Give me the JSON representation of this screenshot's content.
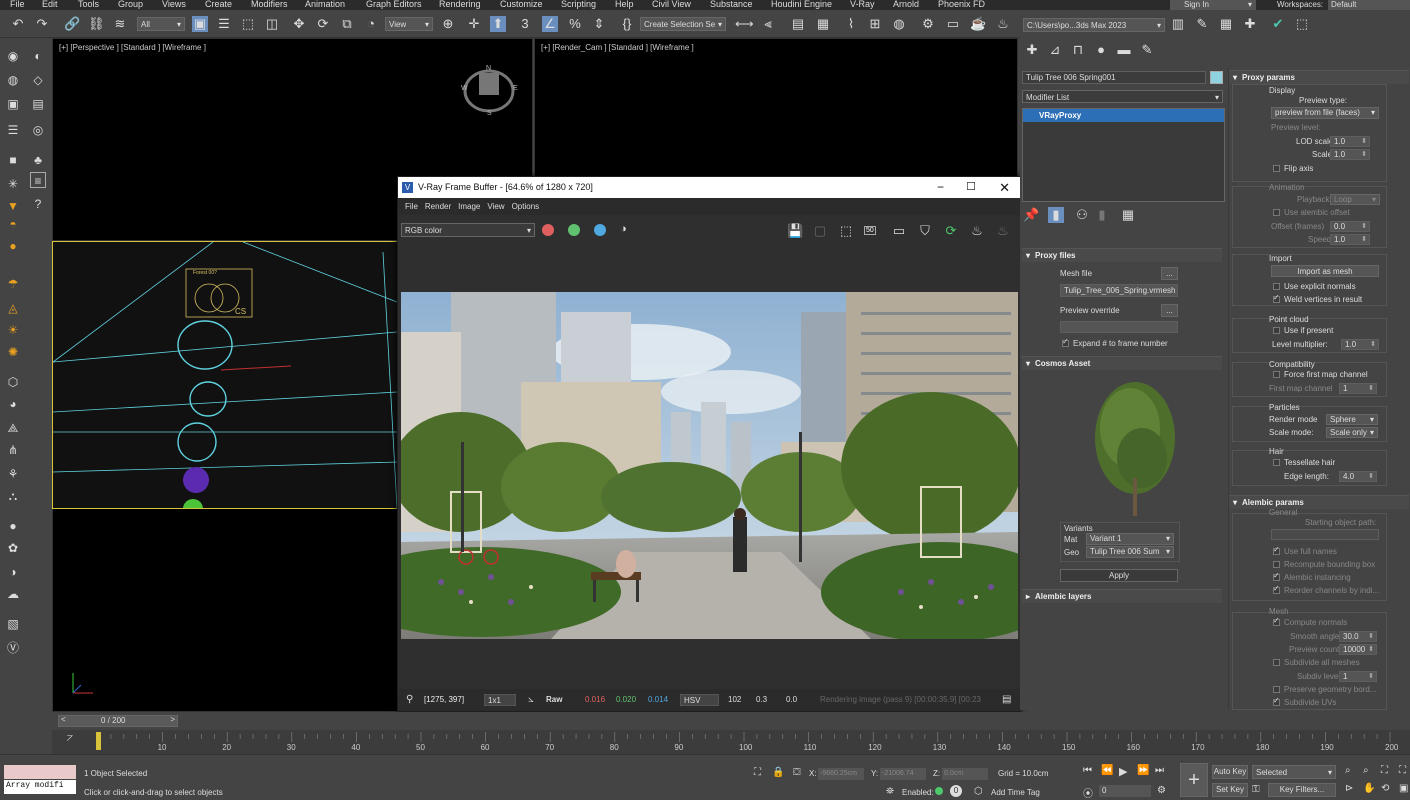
{
  "menu": [
    "File",
    "Edit",
    "Tools",
    "Group",
    "Views",
    "Create",
    "Modifiers",
    "Animation",
    "Graph Editors",
    "Rendering",
    "Customize",
    "Scripting",
    "Help",
    "Civil View",
    "Substance",
    "Houdini Engine",
    "V-Ray",
    "Arnold",
    "Phoenix FD"
  ],
  "signin": "Sign In",
  "workspaces_label": "Workspaces:",
  "workspaces_value": "Default",
  "toolbar": {
    "filter": "All",
    "ref_coord": "View",
    "selection_set": "Create Selection Se",
    "path": "C:\\Users\\po...3ds Max 2023"
  },
  "viewports": {
    "perspective": "[+] [Perspective ] [Standard ] [Wireframe ]",
    "render_cam": "[+] [Render_Cam ] [Standard ] [Wireframe ]",
    "compass_n": "N",
    "compass_w": "W",
    "compass_e": "E",
    "compass_s": "S",
    "forest_label": "Forest 00?",
    "cs_label": "CS"
  },
  "vfb": {
    "title": "V-Ray Frame Buffer - [64.6% of 1280 x 720]",
    "menu": [
      "Render",
      "Image",
      "View",
      "Options"
    ],
    "menu_file": "File",
    "channel": "RGB color",
    "zoom_badge": "50",
    "status": {
      "coords": "[1275, 397]",
      "scale": "1x1",
      "mode": "Raw",
      "r": "0.016",
      "g": "0.020",
      "b": "0.014",
      "space": "HSV",
      "h": "102",
      "s": "0.3",
      "v": "0.0",
      "msg": "Rendering image (pass 9) [00:00:35.9] [00:23"
    }
  },
  "colors": {
    "r": "#e06060",
    "g": "#60c070",
    "b": "#50a8e0",
    "selected": "#2d6fb6"
  },
  "cmd": {
    "object_name": "Tulip Tree 006 Spring001",
    "modifier_list": "Modifier List",
    "stack_item": "VRayProxy",
    "proxy_files": "Proxy files",
    "mesh_file_label": "Mesh file",
    "mesh_file": "Tulip_Tree_006_Spring.vrmesh",
    "preview_override": "Preview override",
    "browse": "...",
    "expand": "Expand # to frame number",
    "cosmos": "Cosmos Asset",
    "variants": "Variants",
    "mat_label": "Mat",
    "mat_value": "Variant 1",
    "geo_label": "Geo",
    "geo_value": "Tulip Tree 006 Sum",
    "apply": "Apply",
    "alembic_layers": "Alembic layers"
  },
  "props": {
    "proxy_params": "Proxy params",
    "display": "Display",
    "preview_type_label": "Preview type:",
    "preview_type": "preview from file (faces)",
    "preview_level": "Preview level:",
    "lod_scale_label": "LOD scale:",
    "lod_scale": "1.0",
    "scale_label": "Scale:",
    "scale": "1.0",
    "flip_axis": "Flip axis",
    "animation": "Animation",
    "playback_label": "Playback:",
    "playback": "Loop",
    "use_alembic_offset": "Use alembic offset",
    "offset_label": "Offset (frames)",
    "offset": "0.0",
    "speed_label": "Speed:",
    "speed": "1.0",
    "import": "Import",
    "import_as_mesh": "Import as mesh",
    "use_explicit_normals": "Use explicit normals",
    "weld_vertices": "Weld vertices in result",
    "point_cloud": "Point cloud",
    "use_if_present": "Use if present",
    "level_multiplier_label": "Level multiplier:",
    "level_multiplier": "1.0",
    "compatibility": "Compatibility",
    "force_first_map": "Force first map channel",
    "first_map_channel_label": "First map channel",
    "first_map_channel": "1",
    "particles": "Particles",
    "render_mode_label": "Render mode",
    "render_mode": "Sphere",
    "scale_mode_label": "Scale mode:",
    "scale_mode": "Scale only",
    "hair": "Hair",
    "tessellate_hair": "Tessellate hair",
    "edge_length_label": "Edge length:",
    "edge_length": "4.0",
    "alembic_params": "Alembic params",
    "general": "General",
    "starting_object_path": "Starting object path:",
    "use_full_names": "Use full names",
    "recompute_bbox": "Recompute bounding box",
    "alembic_instancing": "Alembic instancing",
    "reorder_channels": "Reorder channels by indi...",
    "mesh": "Mesh",
    "compute_normals": "Compute normals",
    "smooth_angle_label": "Smooth angle:",
    "smooth_angle": "30.0",
    "preview_count_label": "Preview count:",
    "preview_count": "10000",
    "subdivide_all_meshes": "Subdivide all meshes",
    "subdiv_level_label": "Subdiv level:",
    "subdiv_level": "1",
    "preserve_geometry": "Preserve geometry bord...",
    "subdivide_uvs": "Subdivide UVs"
  },
  "time": {
    "frame_counter": "0 / 200",
    "ticks": [
      "10",
      "20",
      "30",
      "40",
      "50",
      "60",
      "70",
      "80",
      "90",
      "100",
      "110",
      "120",
      "130",
      "140",
      "150",
      "160",
      "170",
      "180",
      "190",
      "200"
    ],
    "zero": "0"
  },
  "status": {
    "maxscript": "Array modifi",
    "selected": "1 Object Selected",
    "prompt": "Click or click-and-drag to select objects",
    "x_label": "X:",
    "x": "-9660.25cm",
    "y_label": "Y:",
    "y": "-21006.74",
    "z_label": "Z:",
    "z": "0.0cm",
    "grid": "Grid = 10.0cm",
    "enabled": "Enabled:",
    "add_time_tag": "Add Time Tag",
    "auto_key": "Auto Key",
    "set_key": "Set Key",
    "selected_drop": "Selected",
    "key_filters": "Key Filters...",
    "frame": "0"
  }
}
